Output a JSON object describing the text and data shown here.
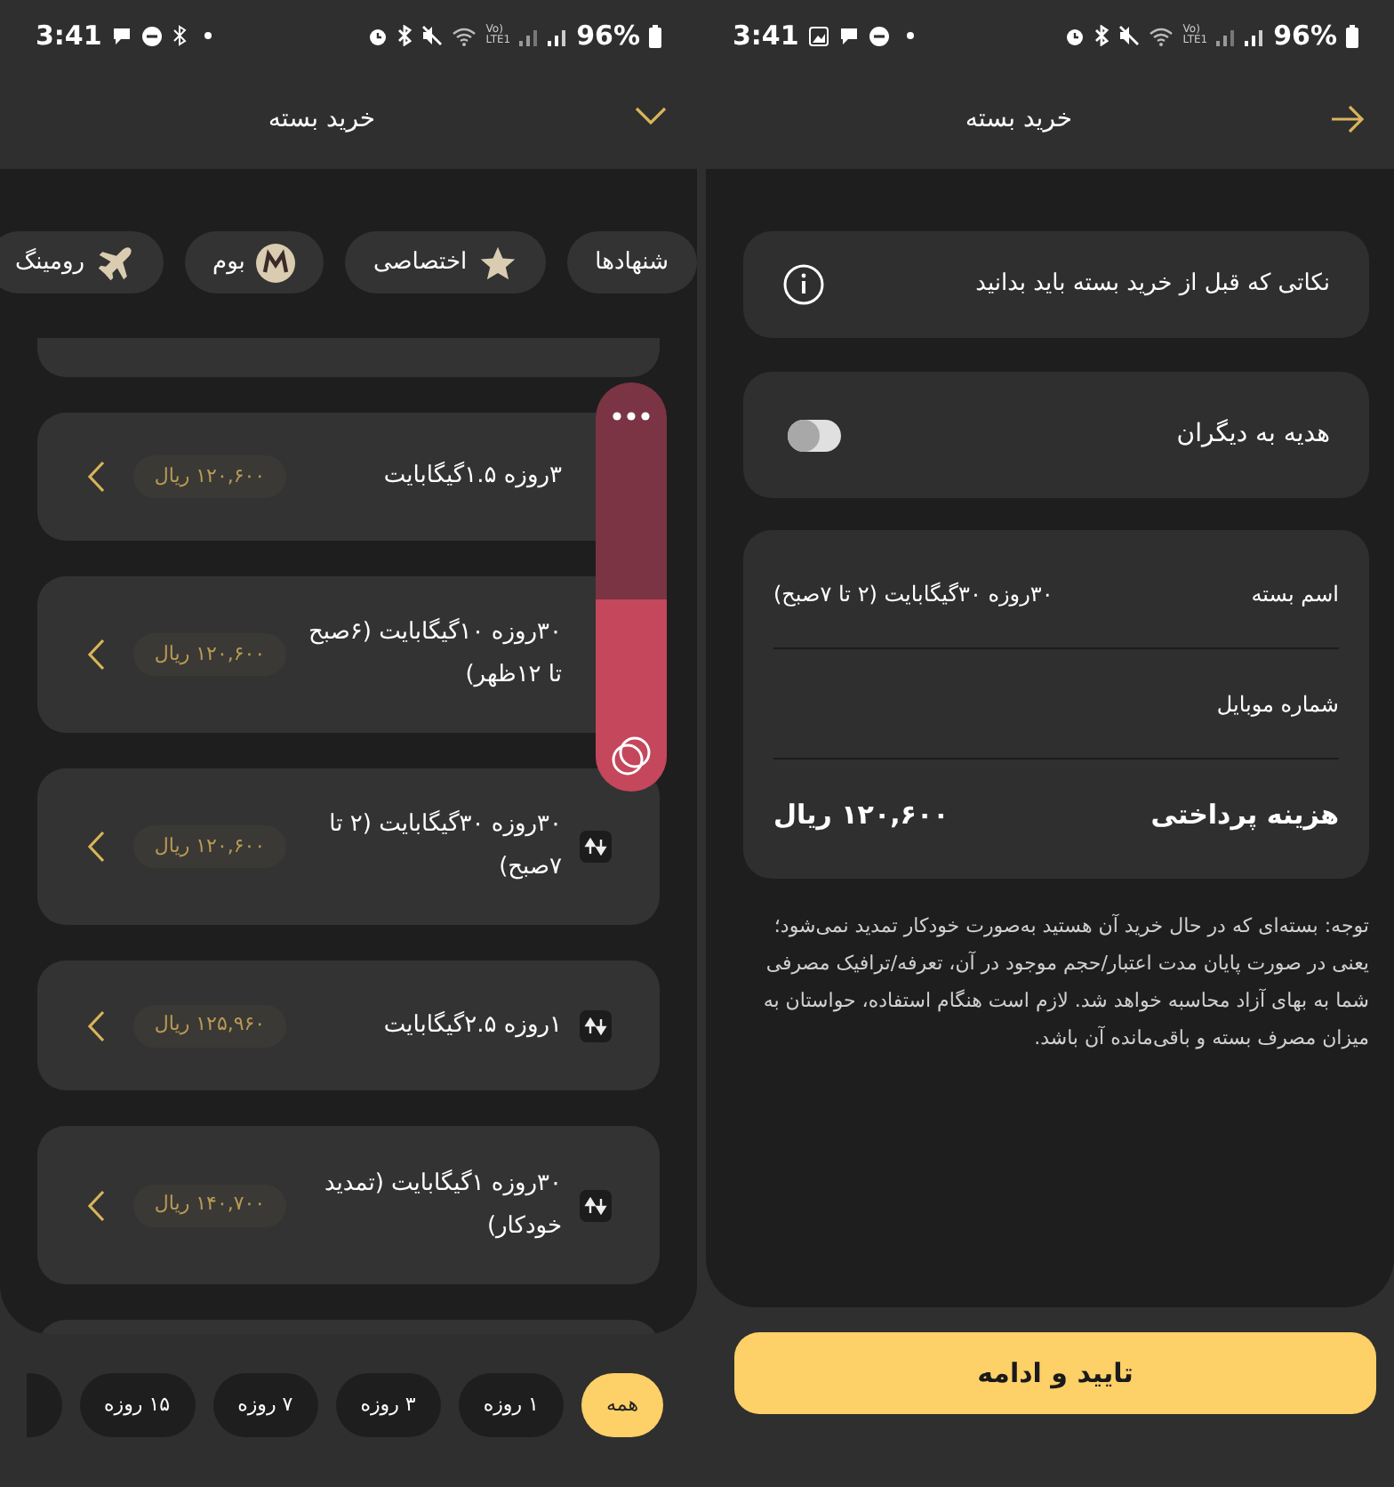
{
  "screens": [
    {
      "status_bar": {
        "time": "3:41",
        "volte_top": "Vo)",
        "volte_bottom": "LTE1",
        "battery": "96%"
      },
      "header": {
        "title": "خرید بسته",
        "kind": "back"
      },
      "info": {
        "label": "نکاتی که قبل از خرید بسته باید بدانید"
      },
      "gift": {
        "label": "هدیه به دیگران",
        "on": false
      },
      "summary": [
        {
          "label": "اسم بسته",
          "value": "۳۰روزه ۳۰گیگابایت (۲ تا ۷صبح)",
          "kind": "normal"
        },
        {
          "label": "شماره موبایل",
          "kind": "normal"
        },
        {
          "label": "هزینه پرداختی",
          "value": "۱۲۰,۶۰۰ ریال",
          "kind": "total"
        }
      ],
      "note": "توجه: بسته‌ای که در حال خرید آن هستید به‌صورت خودکار تمدید نمی‌شود؛ یعنی در صورت پایان مدت اعتبار/حجم موجود در آن، تعرفه/ترافیک مصرفی شما به بهای آزاد محاسبه خواهد شد. لازم است هنگام استفاده، حواستان به میزان مصرف بسته و باقی‌مانده آن باشد.",
      "confirm_button": "تایید و ادامه"
    },
    {
      "status_bar": {
        "time": "3:41",
        "volte_top": "Vo)",
        "volte_bottom": "LTE1",
        "battery": "96%"
      },
      "header": {
        "title": "خرید بسته",
        "kind": "collapse"
      },
      "categories": [
        {
          "label": "شنهادها",
          "kind": "plain"
        },
        {
          "label": "اختصاصی",
          "kind": "star"
        },
        {
          "label": "بوم",
          "kind": "boom"
        },
        {
          "label": "رومینگ",
          "kind": "plane"
        }
      ],
      "packages": [
        {
          "title": "۳روزه ۱.۵گیگابایت",
          "price": "۱۲۰,۶۰۰ ریال"
        },
        {
          "title": "۳۰روزه ۱۰گیگابایت (۶صبح تا ۱۲ظهر)",
          "price": "۱۲۰,۶۰۰ ریال"
        },
        {
          "title": "۳۰روزه ۳۰گیگابایت (۲ تا ۷صبح)",
          "price": "۱۲۰,۶۰۰ ریال"
        },
        {
          "title": "۱روزه ۲.۵گیگابایت",
          "price": "۱۲۵,۹۶۰ ریال"
        },
        {
          "title": "۳۰روزه ۱گیگابایت (تمدید خودکار)",
          "price": "۱۴۰,۷۰۰ ریال"
        }
      ],
      "floating_slider": {
        "level": 0.47
      },
      "filters": [
        {
          "label": "همه",
          "selected": true
        },
        {
          "label": "۱ روزه",
          "selected": false
        },
        {
          "label": "۳ روزه",
          "selected": false
        },
        {
          "label": "۷ روزه",
          "selected": false
        },
        {
          "label": "۱۵ روزه",
          "selected": false
        }
      ]
    }
  ]
}
